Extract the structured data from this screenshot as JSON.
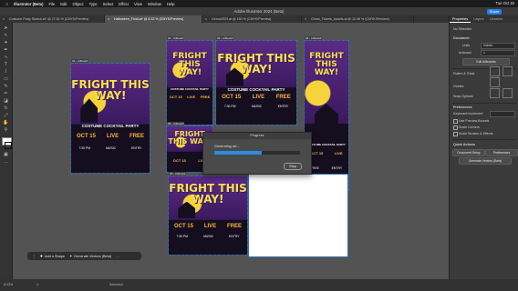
{
  "menubar": {
    "apple": "",
    "items": [
      "Illustrator (Beta)",
      "File",
      "Edit",
      "Object",
      "Type",
      "Select",
      "Effect",
      "View",
      "Window",
      "Help"
    ],
    "clock": "Tue Oct 15"
  },
  "window": {
    "title": "Adobe Illustrator 2024 (Beta)",
    "share_label": "Share"
  },
  "tabs": [
    {
      "label": "Costume Party Sketch.ai* @ 27.51 % (CMYK/Preview)",
      "active": false
    },
    {
      "label": "Halloween_Final.ai* @ 8.33 % (CMYK/Preview)",
      "active": true
    },
    {
      "label": "Circus2024.ai @ 150 % (CMYK/Preview)",
      "active": false
    },
    {
      "label": "Ghost_Tickets_Assets.ai @ 12.46 % (CMYK/Preview)",
      "active": false
    }
  ],
  "posters": {
    "headline": "FRIGHT THIS WAY!",
    "subtitle": "COSTUME COCKTAIL PARTY",
    "date": "OCT 15",
    "time": "7:30 PM",
    "live": "LIVE",
    "music": "MUSIC",
    "free": "FREE",
    "entry": "ENTRY"
  },
  "artboard_labels": [
    "01 - Artboard",
    "02 - Artboard",
    "03 - Artboard",
    "04 - Artboard",
    "05 - Artboard",
    "06 - Artboard",
    "07 - Artboard"
  ],
  "dialog": {
    "title": "Progress",
    "status": "Generating art....",
    "progress_fraction": 0.55,
    "stop_label": "Stop"
  },
  "taskbar": {
    "add_shape": "Add a Shape",
    "generate_vectors": "Generate Vectors (Beta)"
  },
  "statusbar": {
    "zoom": "8.33%",
    "artboard": "1",
    "mode": "Selection"
  },
  "panel": {
    "tabs": [
      "Properties",
      "Layers",
      "Libraries"
    ],
    "no_selection": "No Selection",
    "document": "Document",
    "units_label": "Units",
    "units_value": "Inches",
    "artboard_label": "Artboard",
    "artboard_value": "1",
    "edit_artboards": "Edit Artboards",
    "rulers_grids": "Rulers & Grids",
    "guides": "Guides",
    "snap_options": "Snap Options",
    "preferences": "Preferences",
    "keyboard_increment": "Keyboard Increment",
    "use_preview_bounds": "Use Preview Bounds",
    "scale_corners": "Scale Corners",
    "scale_strokes": "Scale Strokes & Effects",
    "quick_actions": "Quick Actions",
    "document_setup": "Document Setup",
    "preferences_btn": "Preferences",
    "generate_vectors": "Generate Vectors (Beta)"
  },
  "colors": {
    "accent": "#2f8ae3",
    "poster_purple": "#5b2a86",
    "poster_yellow": "#f7e24a"
  }
}
